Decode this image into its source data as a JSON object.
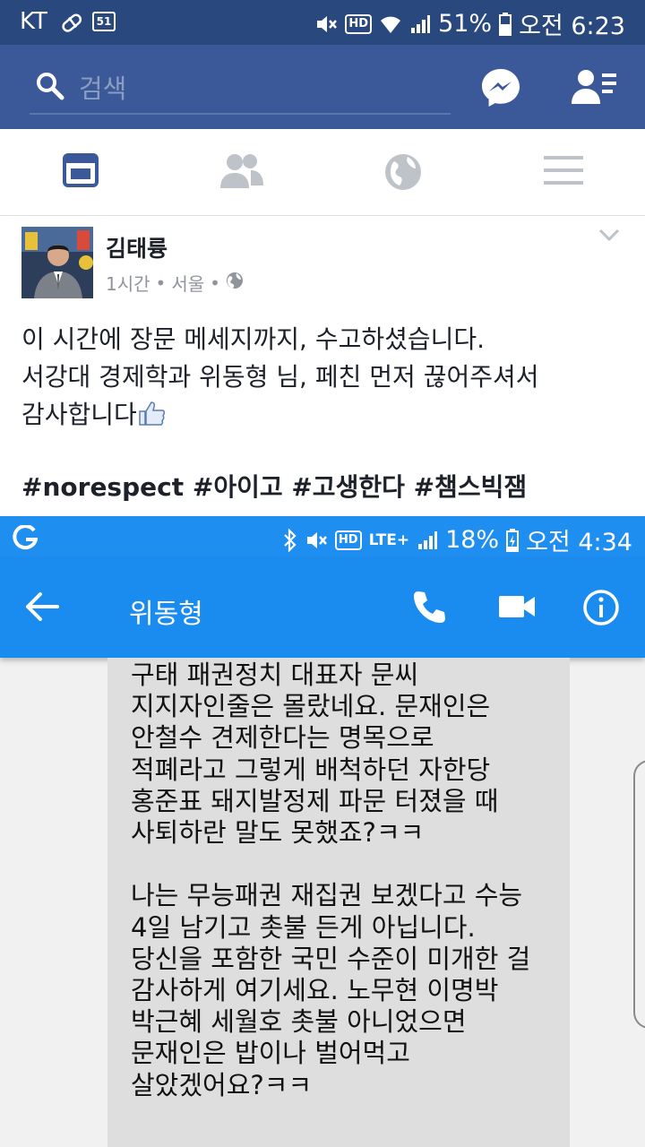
{
  "fb_status": {
    "carrier": "KT",
    "badge": "51",
    "hd": "HD",
    "battery": "51%",
    "time": "오전 6:23"
  },
  "header": {
    "search_placeholder": "검색",
    "accent": "#3b5998"
  },
  "tabs": [
    "news-feed",
    "friends",
    "notifications",
    "menu"
  ],
  "post": {
    "author": "김태륭",
    "time": "1시간",
    "location": "서울",
    "lines": [
      "이 시간에 장문 메세지까지, 수고하셨습니다.",
      "서강대 경제학과 위동형 님, 페친 먼저 끊어주셔서",
      "감사합니다"
    ],
    "hashtags": "#norespect #아이고 #고생한다 #챔스빅잼"
  },
  "screenshot": {
    "status": {
      "hd": "HD",
      "network": "LTE+",
      "battery": "18%",
      "time": "오전 4:34"
    },
    "contact": "위동형",
    "accent": "#1a8cf0",
    "paragraph1": [
      "구태 패권정치 대표자 문씨",
      "지지자인줄은 몰랐네요. 문재인은",
      "안철수 견제한다는 명목으로",
      "적폐라고 그렇게 배척하던 자한당",
      "홍준표 돼지발정제 파문 터졌을 때",
      "사퇴하란 말도 못했죠?ㅋㅋ"
    ],
    "paragraph2": [
      "나는 무능패권 재집권 보겠다고 수능",
      "4일 남기고 촛불 든게 아닙니다.",
      "당신을 포함한 국민 수준이 미개한 걸",
      "감사하게 여기세요. 노무현 이명박",
      "박근혜 세월호 촛불 아니었으면",
      "문재인은 밥이나 벌어먹고",
      "살았겠어요?ㅋㅋ"
    ]
  }
}
